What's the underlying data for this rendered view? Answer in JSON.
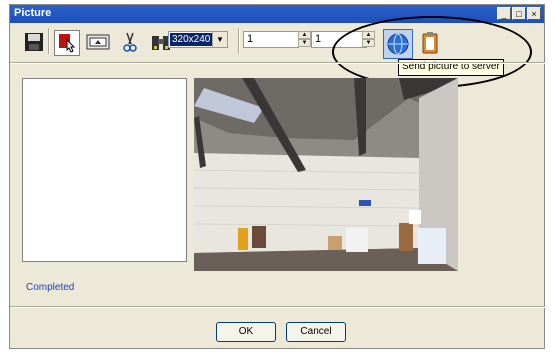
{
  "window": {
    "title": "Picture"
  },
  "title_buttons": [
    "_",
    "□",
    "×"
  ],
  "toolbar": {
    "icons": [
      "save-icon",
      "select-pointer-icon",
      "capture-icon",
      "cut-icon",
      "binoculars-icon",
      "globe-icon",
      "clipboard-icon"
    ],
    "resolution": "320x240",
    "spin1": "1",
    "spin2": "1"
  },
  "tooltip": "Send picture to server",
  "status": "Completed",
  "buttons": {
    "ok": "OK",
    "cancel": "Cancel"
  }
}
